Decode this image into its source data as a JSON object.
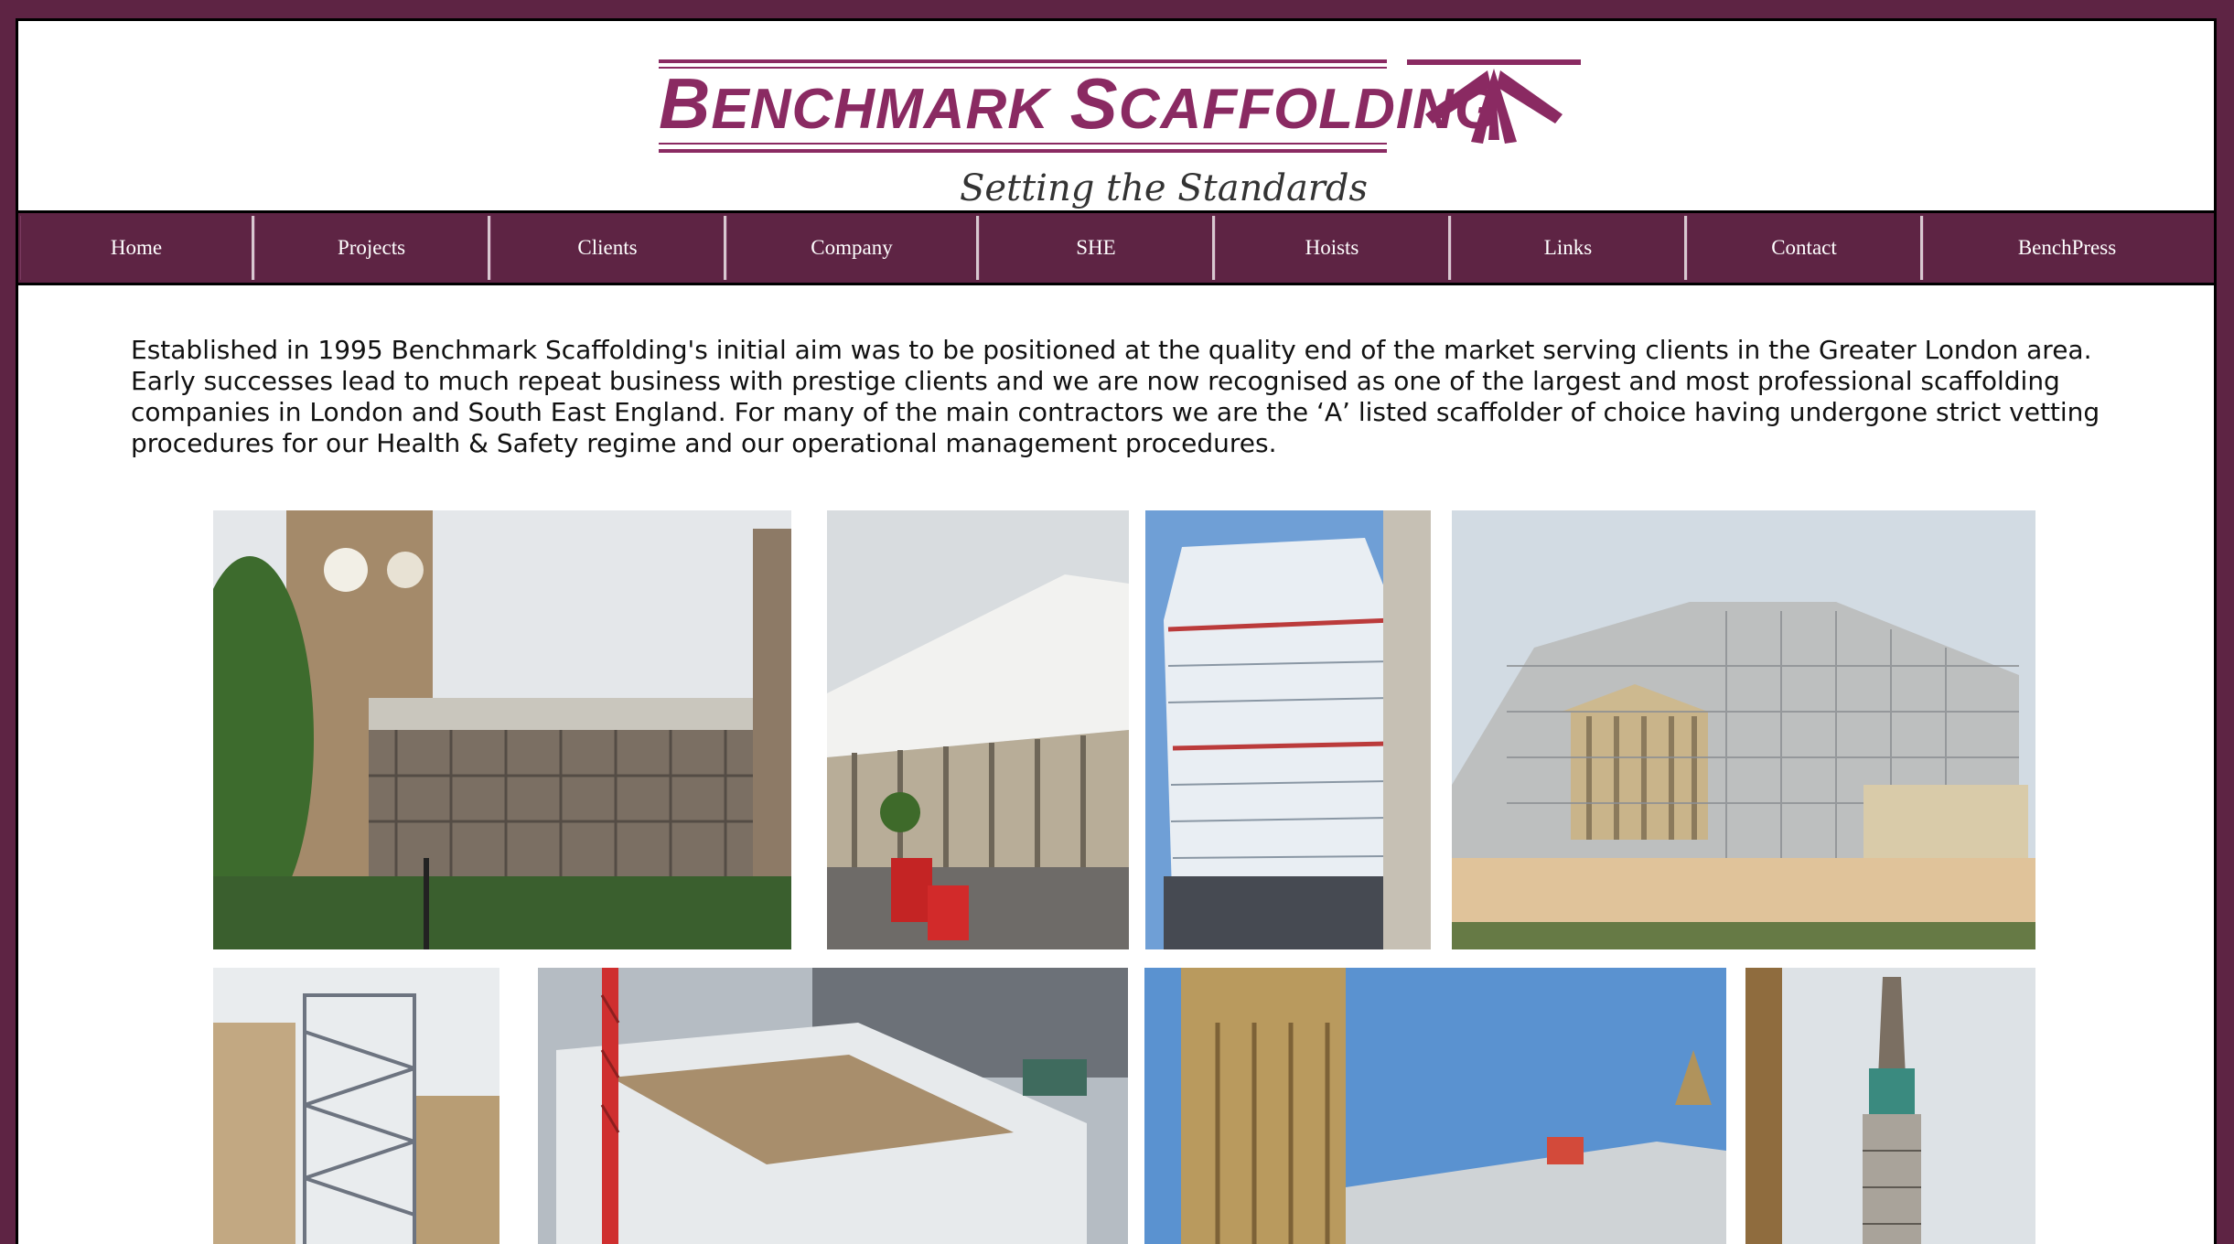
{
  "brand": {
    "name_first_initial": "B",
    "name_first_rest": "ENCHMARK",
    "name_second_initial": "S",
    "name_second_rest": "CAFFOLDING",
    "tagline": "Setting the Standards",
    "color": "#8a2a62"
  },
  "nav": {
    "items": [
      {
        "label": "Home"
      },
      {
        "label": "Projects"
      },
      {
        "label": "Clients"
      },
      {
        "label": "Company"
      },
      {
        "label": "SHE"
      },
      {
        "label": "Hoists"
      },
      {
        "label": "Links"
      },
      {
        "label": "Contact"
      },
      {
        "label": "BenchPress"
      }
    ],
    "background": "#5e2444"
  },
  "intro": {
    "text": "Established in 1995 Benchmark Scaffolding's initial aim was to be positioned at the quality end of the market serving clients in the Greater London area. Early successes lead to much repeat business with prestige clients and we are now recognised as one of the largest and most professional scaffolding companies in London and South East England. For many of the main contractors we are the ‘A’ listed scaffolder of choice having undergone strict vetting procedures for our Health & Safety regime and our operational management procedures."
  },
  "gallery": {
    "photos": [
      {
        "subject": "big-ben-westminster-scaffolding"
      },
      {
        "subject": "department-store-scaffolding"
      },
      {
        "subject": "tower-block-scaffolding"
      },
      {
        "subject": "classical-building-scaffolding"
      },
      {
        "subject": "stair-tower-scaffolding"
      },
      {
        "subject": "rooftop-crane-site"
      },
      {
        "subject": "gothic-tower-scaffolding"
      },
      {
        "subject": "spire-scaffolding"
      }
    ]
  }
}
